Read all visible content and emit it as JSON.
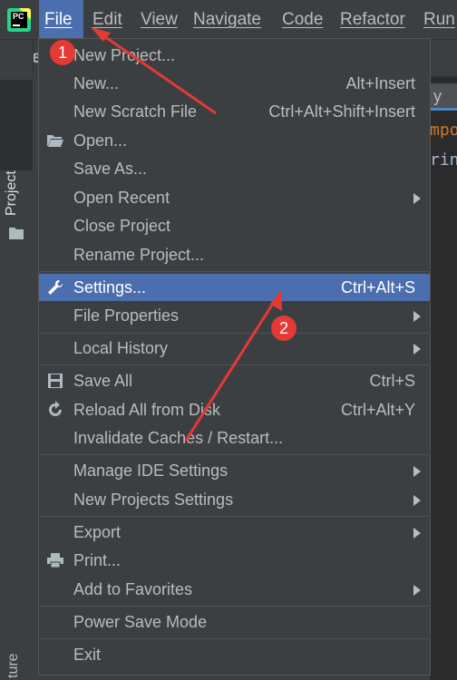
{
  "menubar": {
    "logo_text": "PC",
    "items": [
      "File",
      "Edit",
      "View",
      "Navigate",
      "Code",
      "Refactor",
      "Run"
    ]
  },
  "background": {
    "nav_text": "tse",
    "project_tab": "Project",
    "structure_tab": "ture",
    "editor_tab": "y",
    "code_line_1": "mpo",
    "code_line_2": "rin"
  },
  "file_menu": {
    "items": [
      {
        "label": "New Project...",
        "shortcut": "",
        "submenu": false,
        "icon": ""
      },
      {
        "label": "New...",
        "shortcut": "Alt+Insert",
        "submenu": false,
        "icon": ""
      },
      {
        "label": "New Scratch File",
        "shortcut": "Ctrl+Alt+Shift+Insert",
        "submenu": false,
        "icon": ""
      },
      {
        "label": "Open...",
        "shortcut": "",
        "submenu": false,
        "icon": "folder-open-icon"
      },
      {
        "label": "Save As...",
        "shortcut": "",
        "submenu": false,
        "icon": ""
      },
      {
        "label": "Open Recent",
        "shortcut": "",
        "submenu": true,
        "icon": ""
      },
      {
        "label": "Close Project",
        "shortcut": "",
        "submenu": false,
        "icon": ""
      },
      {
        "label": "Rename Project...",
        "shortcut": "",
        "submenu": false,
        "icon": ""
      },
      {
        "label": "Settings...",
        "shortcut": "Ctrl+Alt+S",
        "submenu": false,
        "icon": "wrench-icon",
        "highlighted": true
      },
      {
        "label": "File Properties",
        "shortcut": "",
        "submenu": true,
        "icon": ""
      },
      {
        "label": "Local History",
        "shortcut": "",
        "submenu": true,
        "icon": ""
      },
      {
        "label": "Save All",
        "shortcut": "Ctrl+S",
        "submenu": false,
        "icon": "save-icon"
      },
      {
        "label": "Reload All from Disk",
        "shortcut": "Ctrl+Alt+Y",
        "submenu": false,
        "icon": "reload-icon"
      },
      {
        "label": "Invalidate Caches / Restart...",
        "shortcut": "",
        "submenu": false,
        "icon": ""
      },
      {
        "label": "Manage IDE Settings",
        "shortcut": "",
        "submenu": true,
        "icon": ""
      },
      {
        "label": "New Projects Settings",
        "shortcut": "",
        "submenu": true,
        "icon": ""
      },
      {
        "label": "Export",
        "shortcut": "",
        "submenu": true,
        "icon": ""
      },
      {
        "label": "Print...",
        "shortcut": "",
        "submenu": false,
        "icon": "print-icon"
      },
      {
        "label": "Add to Favorites",
        "shortcut": "",
        "submenu": true,
        "icon": ""
      },
      {
        "label": "Power Save Mode",
        "shortcut": "",
        "submenu": false,
        "icon": ""
      },
      {
        "label": "Exit",
        "shortcut": "",
        "submenu": false,
        "icon": ""
      }
    ]
  },
  "annotations": {
    "badge_1": "1",
    "badge_2": "2",
    "color": "#e53935"
  },
  "colors": {
    "menu_bg": "#3c3f41",
    "highlight": "#4b6eaf",
    "text": "#bbbbbb"
  }
}
